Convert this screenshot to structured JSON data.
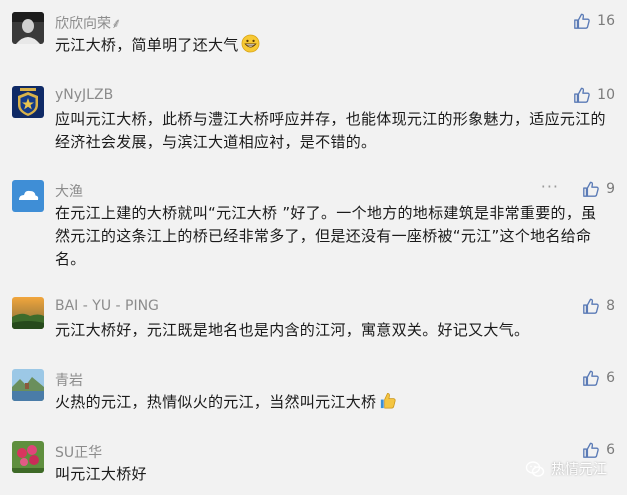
{
  "comments": [
    {
      "name": "欣欣向荣⸙",
      "text": "元江大桥，简单明了还大气",
      "likes": "16",
      "emoji": "grinning-face-icon"
    },
    {
      "name": "yNyJLZB",
      "text": "应叫元江大桥，此桥与澧江大桥呼应并存，也能体现元江的形象魅力，适应元江的经济社会发展，与滨江大道相应衬，是不错的。",
      "likes": "10"
    },
    {
      "name": "大渔",
      "text": "在元江上建的大桥就叫“元江大桥 ”好了。一个地方的地标建筑是非常重要的，虽然元江的这条江上的桥已经非常多了，但是还没有一座桥被“元江”这个地名给命名。",
      "likes": "9",
      "more": "···"
    },
    {
      "name": "BAI - YU - PING",
      "text": "元江大桥好，元江既是地名也是内含的江河，寓意双关。好记又大气。",
      "likes": "8"
    },
    {
      "name": "青岩",
      "text": "火热的元江，热情似火的元江，当然叫元江大桥",
      "likes": "6",
      "emoji": "thumbs-up-icon"
    },
    {
      "name": "SU正华",
      "text": "叫元江大桥好",
      "likes": "6"
    }
  ],
  "watermark": {
    "text": "热情元江"
  },
  "colors": {
    "background": "#f2f2f2",
    "name": "#8c8c8c",
    "text": "#1a1a1a",
    "like": "#7b7b7b"
  }
}
